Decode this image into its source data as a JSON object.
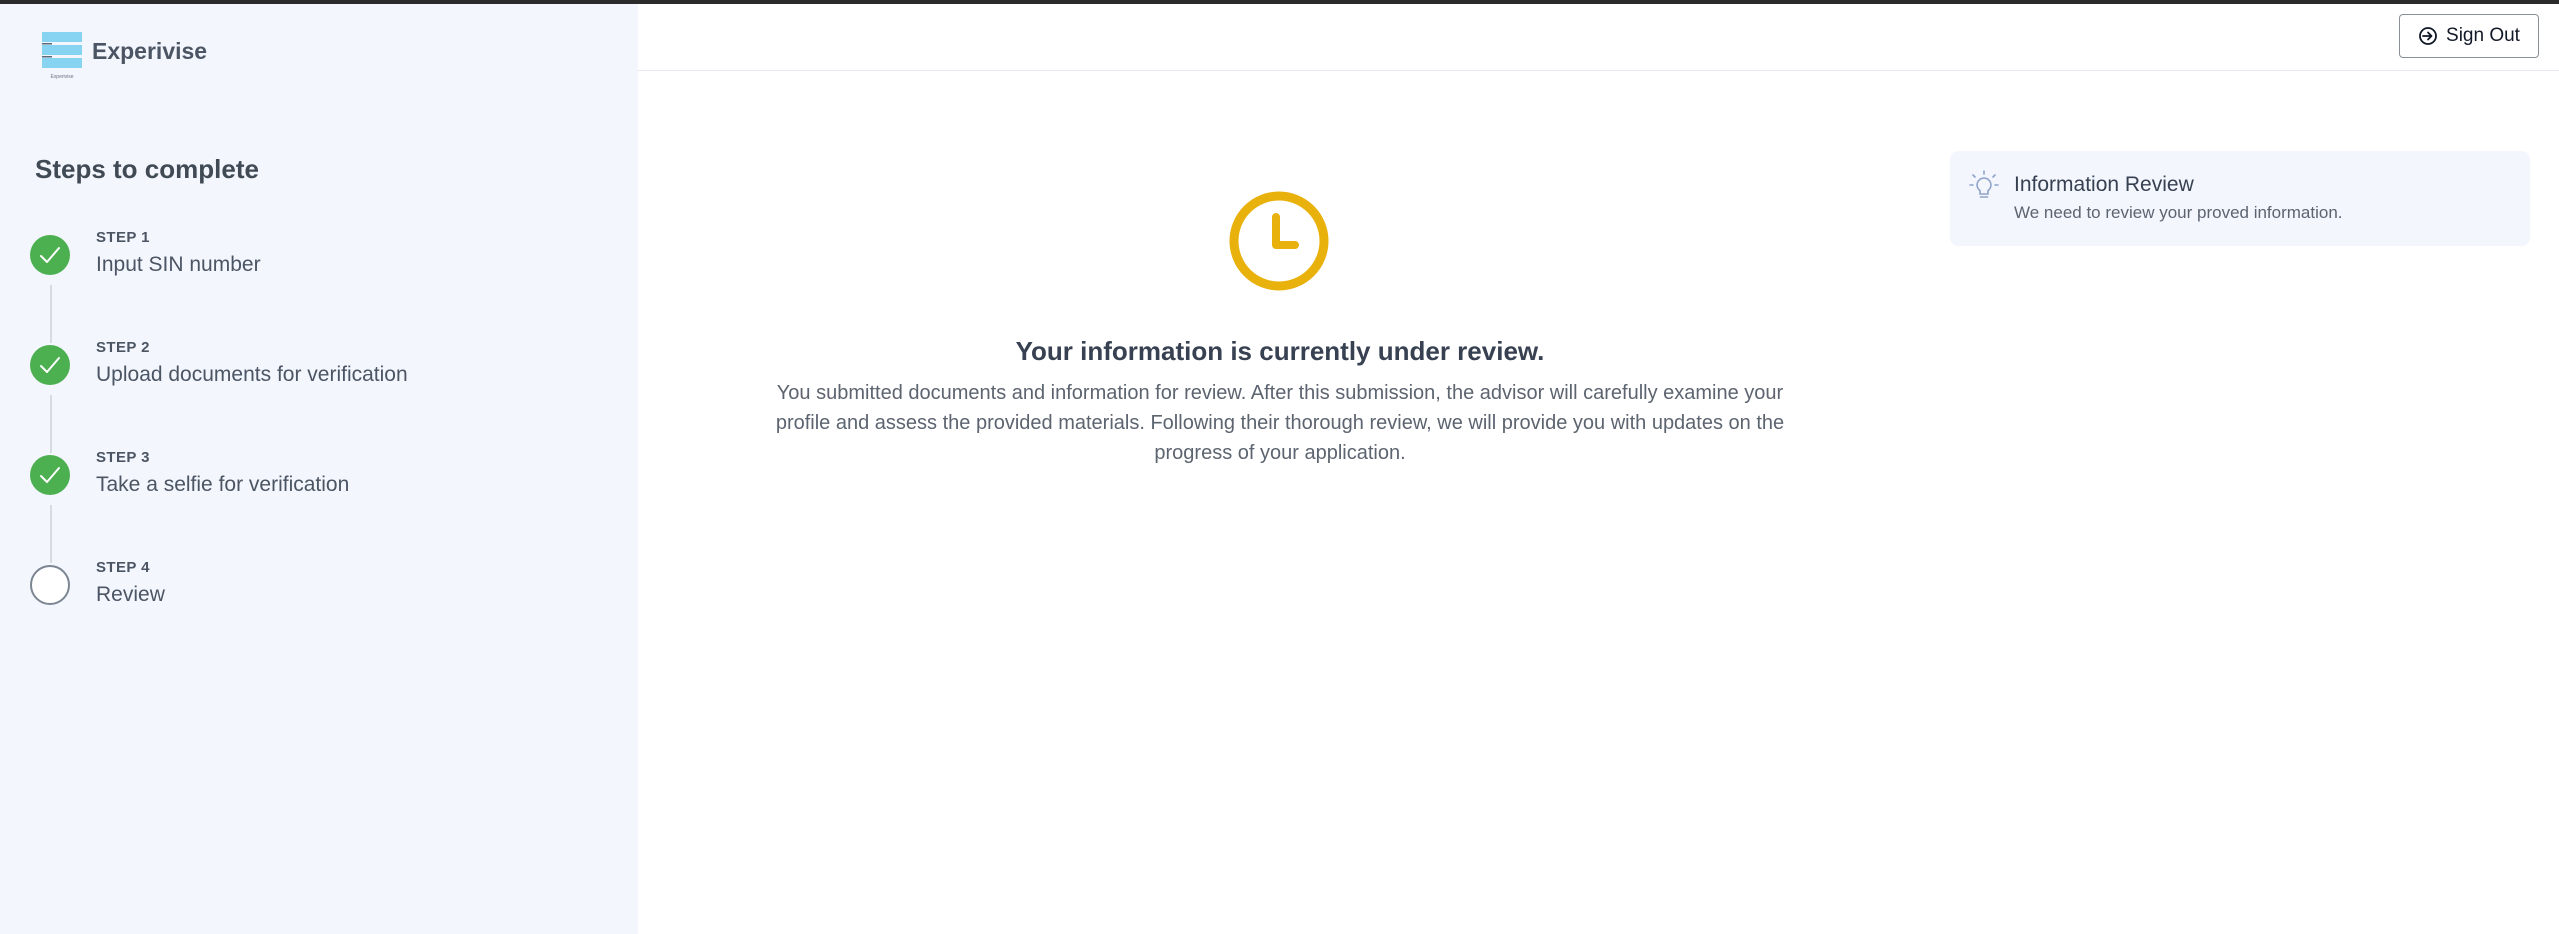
{
  "brand": {
    "name": "Experivise",
    "logo_caption": "Experivise"
  },
  "sidebar": {
    "title": "Steps to complete",
    "steps": [
      {
        "label": "STEP 1",
        "name": "Input SIN number",
        "status": "done"
      },
      {
        "label": "STEP 2",
        "name": "Upload documents for verification",
        "status": "done"
      },
      {
        "label": "STEP 3",
        "name": "Take a selfie for verification",
        "status": "done"
      },
      {
        "label": "STEP 4",
        "name": "Review",
        "status": "pending"
      }
    ]
  },
  "header": {
    "signout_label": "Sign Out"
  },
  "main": {
    "icon": "clock-icon",
    "title": "Your information is currently under review.",
    "description": "You submitted documents and information for review. After this submission, the advisor will carefully examine your profile and assess the provided materials. Following their thorough review, we will provide you with updates on the progress of your application."
  },
  "info_card": {
    "icon": "lightbulb-icon",
    "title": "Information Review",
    "subtitle": "We need to review your proved information."
  },
  "colors": {
    "sidebar_bg": "#f3f6fd",
    "step_done": "#4caf50",
    "clock": "#e9b10c",
    "logo": "#86d3f2"
  }
}
